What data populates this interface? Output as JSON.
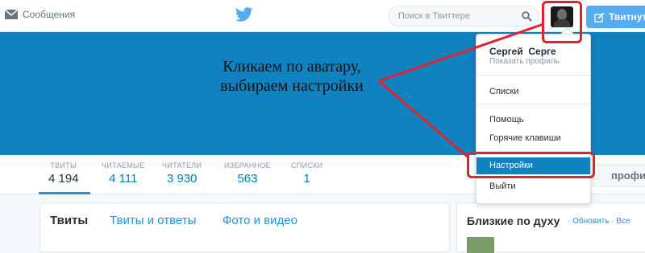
{
  "topbar": {
    "messages_label": "Сообщения",
    "search_placeholder": "Поиск в Твиттере",
    "tweet_button_label": "Твитнуть",
    "icons": [
      "envelope-icon",
      "twitter-bird-icon",
      "search-icon",
      "quill-icon"
    ]
  },
  "annotation": {
    "line1": "Кликаем по аватару,",
    "line2": "выбираем настройки"
  },
  "stats": [
    {
      "label": "ТВИТЫ",
      "value": "4 194"
    },
    {
      "label": "ЧИТАЕМЫЕ",
      "value": "4 111"
    },
    {
      "label": "ЧИТАТЕЛИ",
      "value": "3 930"
    },
    {
      "label": "ИЗБРАННОЕ",
      "value": "563"
    },
    {
      "label": "СПИСКИ",
      "value": "1"
    }
  ],
  "profile_button_label": "профиль",
  "tabs": [
    "Твиты",
    "Твиты и ответы",
    "Фото и видео"
  ],
  "sidebar": {
    "title": "Близкие по духу",
    "refresh_link": "Обновить",
    "all_link": "Все",
    "separator": "·"
  },
  "dropdown": {
    "user_name": "Сергей  Серге",
    "view_profile": "Показать профиль",
    "lists": "Списки",
    "help": "Помощь",
    "hotkeys": "Горячие клавиши",
    "settings": "Настройки",
    "logout": "Выйти"
  },
  "colors": {
    "banner": "#0f82bf",
    "accent": "#1b95e0",
    "highlight": "#e0242f",
    "tweet_button": "#55acee"
  }
}
